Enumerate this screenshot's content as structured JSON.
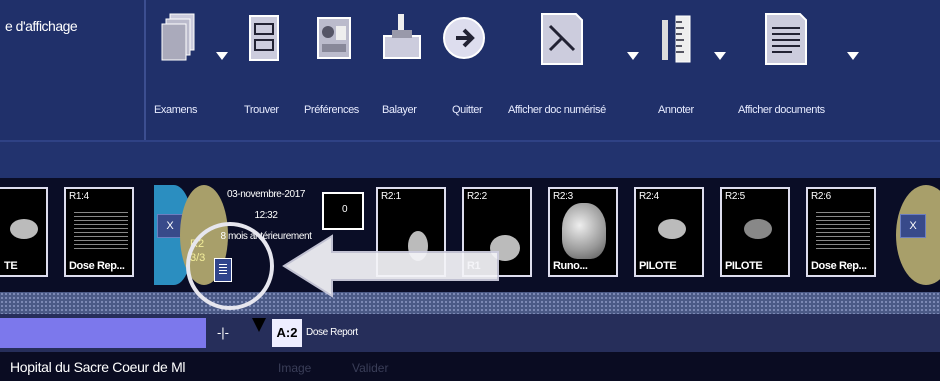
{
  "toolbar": {
    "left_caption": "e d'affichage",
    "tools": [
      {
        "label": "Examens",
        "icon": "exam-stack-icon"
      },
      {
        "label": "Trouver",
        "icon": "file-cabinet-icon"
      },
      {
        "label": "Préférences",
        "icon": "preferences-icon"
      },
      {
        "label": "Balayer",
        "icon": "scanner-icon"
      },
      {
        "label": "Quitter",
        "icon": "exit-arrow-icon"
      },
      {
        "label": "Afficher doc numérisé",
        "icon": "scanned-doc-icon"
      },
      {
        "label": "Annoter",
        "icon": "annotate-ruler-icon"
      },
      {
        "label": "Afficher documents",
        "icon": "documents-icon"
      }
    ]
  },
  "strip": {
    "prev_series": [
      {
        "label": "",
        "bottom": "TE"
      },
      {
        "label": "R1:4",
        "bottom": "Dose Rep..."
      }
    ],
    "close_label": "X",
    "study": {
      "date": "03-novembre-2017",
      "time": "12:32",
      "ago": "8 mois antérieurement",
      "series_mark_top": "R2",
      "series_mark_bottom": "3/3",
      "box_text": "0"
    },
    "series": [
      {
        "label": "R2:1",
        "bottom": ""
      },
      {
        "label": "R2:2",
        "bottom": "R1"
      },
      {
        "label": "R2:3",
        "bottom": "Runo..."
      },
      {
        "label": "R2:4",
        "bottom": "PILOTE"
      },
      {
        "label": "R2:5",
        "bottom": "PILOTE"
      },
      {
        "label": "R2:6",
        "bottom": "Dose Rep..."
      }
    ]
  },
  "viewer": {
    "pin": "-|-",
    "tab_label": "A:2",
    "tab_title": "Dose Report"
  },
  "status": {
    "hospital": "Hopital du Sacre Coeur de Ml",
    "dim1": "Image",
    "dim2": "Valider"
  },
  "colors": {
    "toolbar_bg": "#20306a",
    "series_field": "#7c78ec",
    "annotation": "#ffffff"
  }
}
